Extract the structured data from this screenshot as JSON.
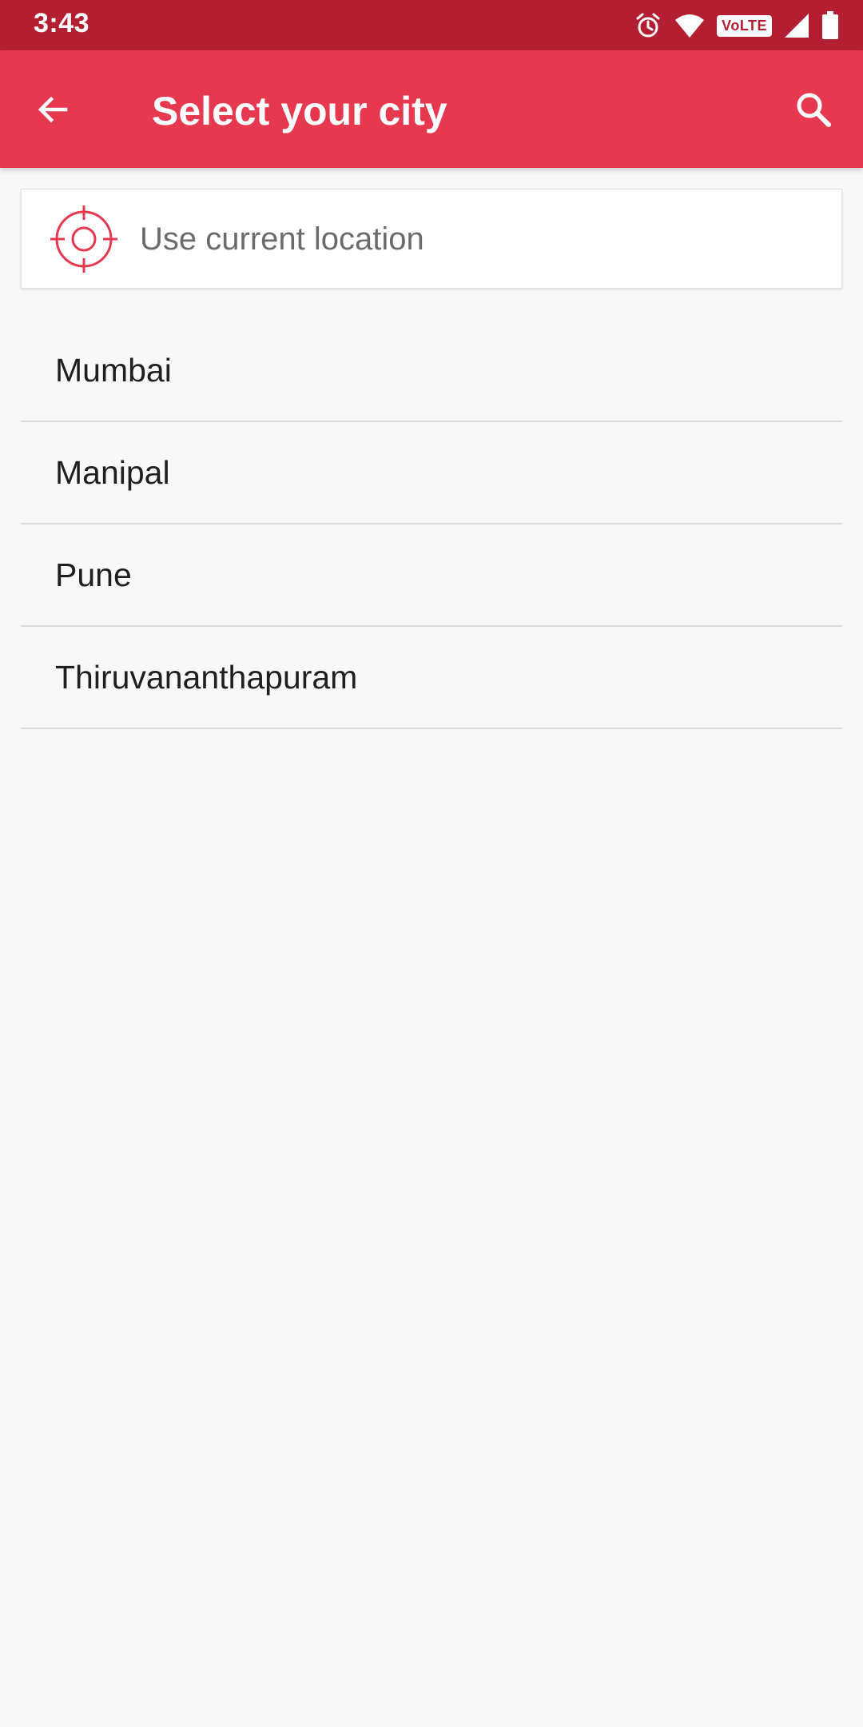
{
  "status_bar": {
    "time": "3:43",
    "icons": [
      "alarm-icon",
      "wifi-icon",
      "volte-icon",
      "signal-icon",
      "battery-icon"
    ],
    "volte_label": "VoLTE"
  },
  "app_bar": {
    "title": "Select your city",
    "back_icon": "arrow-left-icon",
    "search_icon": "search-icon",
    "background_color": "#e6384f"
  },
  "location": {
    "label": "Use current location",
    "icon": "crosshair-icon",
    "icon_color": "#e6384f"
  },
  "cities": [
    {
      "name": "Mumbai"
    },
    {
      "name": "Manipal"
    },
    {
      "name": "Pune"
    },
    {
      "name": "Thiruvananthapuram"
    }
  ]
}
